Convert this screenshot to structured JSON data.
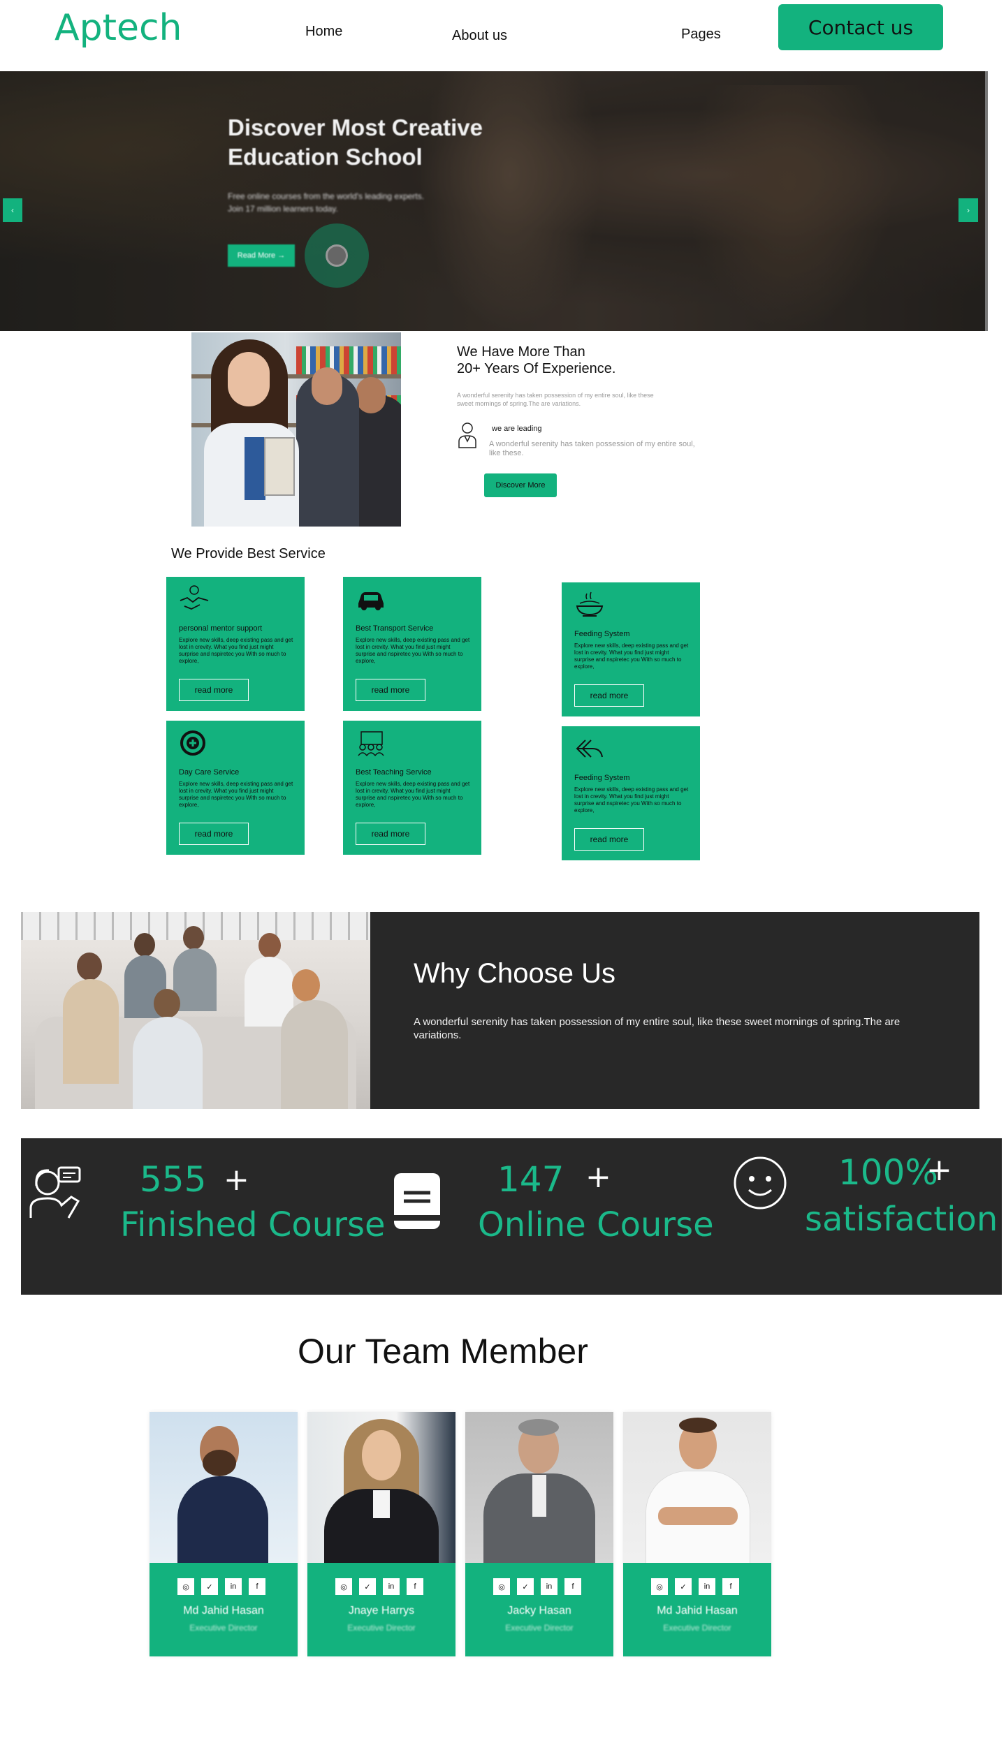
{
  "header": {
    "logo": "Aptech",
    "nav": [
      "Home",
      "About us",
      "Pages"
    ],
    "contact_label": "Contact us"
  },
  "hero": {
    "title_line1": "Discover Most Creative",
    "title_line2": "Education School",
    "subtitle_line1": "Free online courses from the world's leading experts.",
    "subtitle_line2": "Join 17 million learners today.",
    "button_label": "Read More →"
  },
  "about": {
    "heading_line1": "We Have More Than",
    "heading_line2": "20+ Years Of Experience.",
    "paragraph": "A wonderful serenity has taken possession of my entire soul, like these sweet mornings of spring.The are variations.",
    "leading_title": "we are leading",
    "leading_text": "A wonderful serenity has taken possession of my entire soul, like these.",
    "button_label": "Discover More"
  },
  "services": {
    "heading": "We Provide Best Service",
    "cards": [
      {
        "title": "personal mentor support",
        "icon": "handshake-icon",
        "desc": "Explore new skills, deep existing pass and get lost in crevity. What you find just might surprise and nspiretec you With so much to explore,",
        "button": "read more"
      },
      {
        "title": "Best Transport Service",
        "icon": "car-icon",
        "desc": "Explore new skills, deep existing pass and get lost in crevity. What you find just might surprise and nspiretec you With so much to explore,",
        "button": "read more"
      },
      {
        "title": "Feeding System",
        "icon": "food-bowl-icon",
        "desc": "Explore new skills, deep existing pass and get lost in crevity. What you find just might surprise and nspiretec you With so much to explore,",
        "button": "read more"
      },
      {
        "title": "Day Care Service",
        "icon": "medical-cross-icon",
        "desc": "Explore new skills, deep existing pass and get lost in crevity. What you find just might surprise and nspiretec you With so much to explore,",
        "button": "read more"
      },
      {
        "title": "Best Teaching Service",
        "icon": "teacher-board-icon",
        "desc": "Explore new skills, deep existing pass and get lost in crevity. What you find just might surprise and nspiretec you With so much to explore,",
        "button": "read more"
      },
      {
        "title": "Feeding System",
        "icon": "reply-arrow-icon",
        "desc": "Explore new skills, deep existing pass and get lost in crevity. What you find just might surprise and nspiretec you With so much to explore,",
        "button": "read more"
      }
    ]
  },
  "why": {
    "heading": "Why Choose Us",
    "paragraph": "A wonderful serenity has taken possession of my entire soul, like these sweet mornings of spring.The are variations."
  },
  "stats": [
    {
      "value": "555",
      "suffix": "+",
      "label": "Finished Course",
      "icon": "student-chat-icon"
    },
    {
      "value": "147",
      "suffix": "+",
      "label": "Online Course",
      "icon": "book-icon"
    },
    {
      "value": "100%",
      "suffix": "+",
      "label": "satisfaction",
      "icon": "smiley-icon"
    }
  ],
  "team": {
    "heading": "Our Team Member",
    "social": [
      "◎",
      "✓",
      "in",
      "f"
    ],
    "members": [
      {
        "name": "Md Jahid Hasan",
        "role": "Executive Director"
      },
      {
        "name": "Jnaye Harrys",
        "role": "Executive Director"
      },
      {
        "name": "Jacky Hasan",
        "role": "Executive Director"
      },
      {
        "name": "Md Jahid Hasan",
        "role": "Executive Director"
      }
    ]
  },
  "colors": {
    "accent": "#13b27e",
    "dark": "#282828"
  }
}
